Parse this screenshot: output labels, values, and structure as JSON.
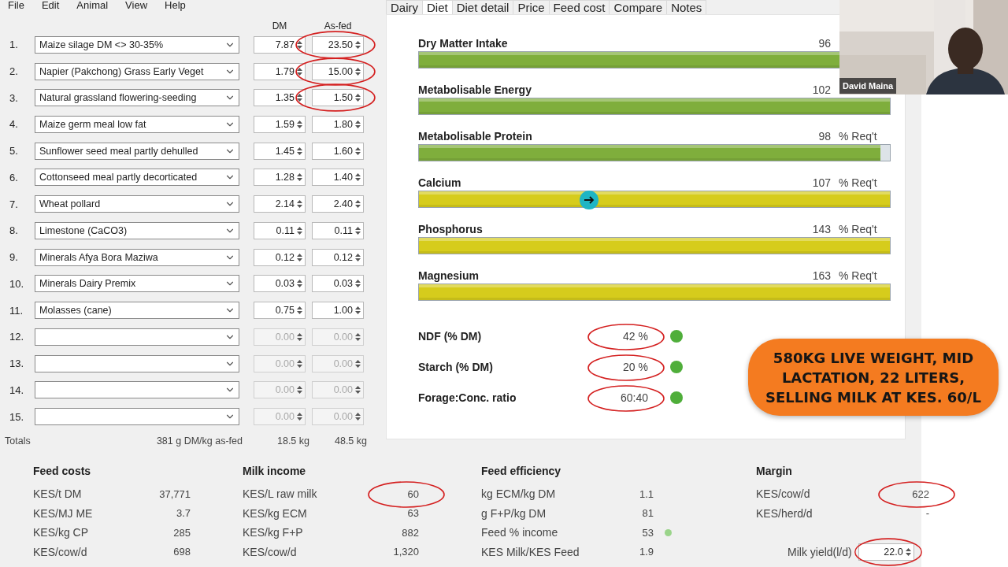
{
  "menu": [
    "File",
    "Edit",
    "Animal",
    "View",
    "Help"
  ],
  "ingredients": {
    "columns": [
      "DM",
      "As-fed"
    ],
    "rows": [
      {
        "number": "1.",
        "feed": "Maize silage DM <> 30-35%",
        "dm": "7.87",
        "as_fed": "23.50",
        "disabled": false,
        "circled": true
      },
      {
        "number": "2.",
        "feed": "Napier (Pakchong) Grass Early Veget",
        "dm": "1.79",
        "as_fed": "15.00",
        "disabled": false,
        "circled": true
      },
      {
        "number": "3.",
        "feed": "Natural grassland flowering-seeding",
        "dm": "1.35",
        "as_fed": "1.50",
        "disabled": false,
        "circled": true
      },
      {
        "number": "4.",
        "feed": "Maize germ meal low fat",
        "dm": "1.59",
        "as_fed": "1.80",
        "disabled": false,
        "circled": false
      },
      {
        "number": "5.",
        "feed": "Sunflower seed meal partly dehulled",
        "dm": "1.45",
        "as_fed": "1.60",
        "disabled": false,
        "circled": false
      },
      {
        "number": "6.",
        "feed": "Cottonseed meal partly decorticated",
        "dm": "1.28",
        "as_fed": "1.40",
        "disabled": false,
        "circled": false
      },
      {
        "number": "7.",
        "feed": "Wheat pollard",
        "dm": "2.14",
        "as_fed": "2.40",
        "disabled": false,
        "circled": false
      },
      {
        "number": "8.",
        "feed": "Limestone (CaCO3)",
        "dm": "0.11",
        "as_fed": "0.11",
        "disabled": false,
        "circled": false
      },
      {
        "number": "9.",
        "feed": "Minerals Afya Bora Maziwa",
        "dm": "0.12",
        "as_fed": "0.12",
        "disabled": false,
        "circled": false
      },
      {
        "number": "10.",
        "feed": "Minerals Dairy Premix",
        "dm": "0.03",
        "as_fed": "0.03",
        "disabled": false,
        "circled": false
      },
      {
        "number": "11.",
        "feed": "Molasses (cane)",
        "dm": "0.75",
        "as_fed": "1.00",
        "disabled": false,
        "circled": false
      },
      {
        "number": "12.",
        "dm": "0.00",
        "as_fed": "0.00",
        "disabled": true,
        "circled": false
      },
      {
        "number": "13.",
        "dm": "0.00",
        "as_fed": "0.00",
        "disabled": true,
        "circled": false
      },
      {
        "number": "14.",
        "dm": "0.00",
        "as_fed": "0.00",
        "disabled": true,
        "circled": false
      },
      {
        "number": "15.",
        "dm": "0.00",
        "as_fed": "0.00",
        "disabled": true,
        "circled": false
      }
    ],
    "totals": {
      "label": "Totals",
      "density": "381 g DM/kg as-fed",
      "dm": "18.5 kg",
      "as_fed": "48.5 kg"
    }
  },
  "tabs": [
    {
      "label": "Dairy",
      "selected": false
    },
    {
      "label": "Diet",
      "selected": true
    },
    {
      "label": "Diet detail",
      "selected": false
    },
    {
      "label": "Price",
      "selected": false
    },
    {
      "label": "Feed cost",
      "selected": false
    },
    {
      "label": "Compare",
      "selected": false
    },
    {
      "label": "Notes",
      "selected": false
    }
  ],
  "diet": {
    "bars": [
      {
        "label": "Dry Matter Intake",
        "value": "96",
        "level": 0.96,
        "color": "#7fae3c"
      },
      {
        "label": "Metabolisable Energy",
        "value": "102",
        "level": 1,
        "color": "#7fae3c"
      },
      {
        "label": "Metabolisable Protein",
        "value": "98",
        "unit": "% Req't",
        "level": 0.98,
        "color": "#7fae3c"
      },
      {
        "label": "Calcium",
        "value": "107",
        "unit": "% Req't",
        "level": 1,
        "color": "#d6cc1c"
      },
      {
        "label": "Phosphorus",
        "value": "143",
        "unit": "% Req't",
        "level": 1,
        "color": "#d6cc1c"
      },
      {
        "label": "Magnesium",
        "value": "163",
        "unit": "% Req't",
        "level": 1,
        "color": "#d6cc1c"
      }
    ],
    "indicators": [
      {
        "label": "NDF (% DM)",
        "value": "42 %",
        "circled": true,
        "color": "#4fae3a"
      },
      {
        "label": "Starch (% DM)",
        "value": "20 %",
        "circled": true,
        "color": "#4fae3a"
      },
      {
        "label": "Forage:Conc. ratio",
        "value": "60:40",
        "circled": true,
        "color": "#4fae3a"
      }
    ]
  },
  "summary": [
    {
      "title": "Feed costs",
      "rows": [
        {
          "label": "KES/t DM",
          "value": "37,771",
          "circled": false
        },
        {
          "label": "KES/MJ ME",
          "value": "3.7",
          "circled": false
        },
        {
          "label": "KES/kg CP",
          "value": "285",
          "circled": false
        },
        {
          "label": "KES/cow/d",
          "value": "698",
          "circled": false
        }
      ]
    },
    {
      "title": "Milk income",
      "rows": [
        {
          "label": "KES/L raw milk",
          "value": "60",
          "circled": true
        },
        {
          "label": "KES/kg ECM",
          "value": "63",
          "circled": false
        },
        {
          "label": "KES/kg F+P",
          "value": "882",
          "circled": false
        },
        {
          "label": "KES/cow/d",
          "value": "1,320",
          "circled": false
        }
      ]
    },
    {
      "title": "Feed efficiency",
      "rows": [
        {
          "label": "kg ECM/kg DM",
          "value": "1.1",
          "circled": false
        },
        {
          "label": "g F+P/kg DM",
          "value": "81",
          "circled": false
        },
        {
          "label": "Feed % income",
          "value": "53",
          "circled": false,
          "color": "#9ad48a"
        },
        {
          "label": "KES Milk/KES Feed",
          "value": "1.9",
          "circled": false
        }
      ]
    },
    {
      "title": "Margin",
      "rows": [
        {
          "label": "KES/cow/d",
          "value": "622",
          "circled": true
        },
        {
          "label": "KES/herd/d",
          "value": "-",
          "circled": false
        }
      ]
    }
  ],
  "milk_yield": {
    "label": "Milk yield(l/d)",
    "value": "22.0",
    "circled": true
  },
  "callout": "580KG LIVE WEIGHT, MID LACTATION, 22 LITERS, SELLING MILK AT KES. 60/L",
  "video": {
    "kind": "picture",
    "name": "David Maina"
  }
}
